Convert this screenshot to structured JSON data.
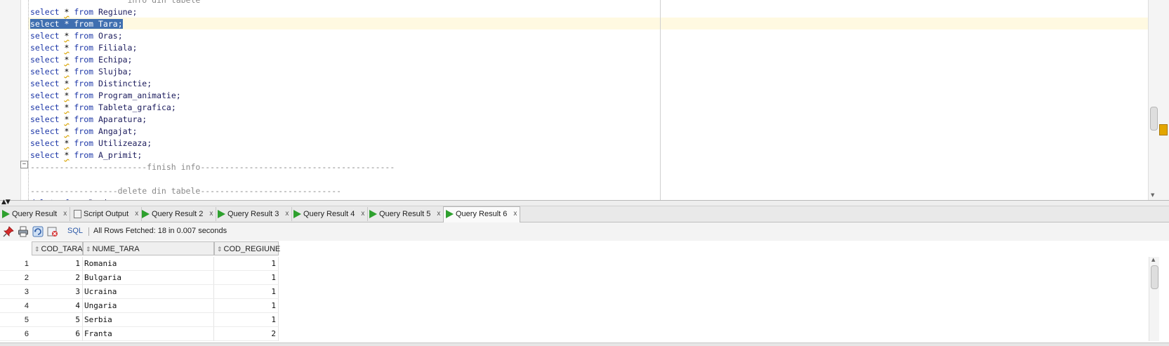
{
  "editor": {
    "lines": [
      {
        "type": "comment",
        "text": "                    info din tabele"
      },
      {
        "type": "select",
        "kw": "select",
        "star": "*",
        "from": "from",
        "table": "Regiune;"
      },
      {
        "type": "select",
        "kw": "select",
        "star": "*",
        "from": "from",
        "table": "Tara;",
        "selected": true
      },
      {
        "type": "select",
        "kw": "select",
        "star": "*",
        "from": "from",
        "table": "Oras;"
      },
      {
        "type": "select",
        "kw": "select",
        "star": "*",
        "from": "from",
        "table": "Filiala;"
      },
      {
        "type": "select",
        "kw": "select",
        "star": "*",
        "from": "from",
        "table": "Echipa;"
      },
      {
        "type": "select",
        "kw": "select",
        "star": "*",
        "from": "from",
        "table": "Slujba;"
      },
      {
        "type": "select",
        "kw": "select",
        "star": "*",
        "from": "from",
        "table": "Distinctie;"
      },
      {
        "type": "select",
        "kw": "select",
        "star": "*",
        "from": "from",
        "table": "Program_animatie;"
      },
      {
        "type": "select",
        "kw": "select",
        "star": "*",
        "from": "from",
        "table": "Tableta_grafica;"
      },
      {
        "type": "select",
        "kw": "select",
        "star": "*",
        "from": "from",
        "table": "Aparatura;"
      },
      {
        "type": "select",
        "kw": "select",
        "star": "*",
        "from": "from",
        "table": "Angajat;"
      },
      {
        "type": "select",
        "kw": "select",
        "star": "*",
        "from": "from",
        "table": "Utilizeaza;"
      },
      {
        "type": "select",
        "kw": "select",
        "star": "*",
        "from": "from",
        "table": "A_primit;"
      },
      {
        "type": "comment",
        "text": "------------------------finish info----------------------------------------"
      },
      {
        "type": "blank",
        "text": ""
      },
      {
        "type": "comment",
        "text": "------------------delete din tabele-----------------------------"
      },
      {
        "type": "delete",
        "kw": "delete",
        "from": "from",
        "table": "Regiune;"
      }
    ],
    "fold_toggle": "−",
    "splitter_arrows": "▲▼"
  },
  "tabs": [
    {
      "label": "Query Result",
      "icon": "play-icon",
      "close": "x"
    },
    {
      "label": "Script Output",
      "icon": "script-icon",
      "close": "x"
    },
    {
      "label": "Query Result 2",
      "icon": "play-icon",
      "close": "x"
    },
    {
      "label": "Query Result 3",
      "icon": "play-icon",
      "close": "x"
    },
    {
      "label": "Query Result 4",
      "icon": "play-icon",
      "close": "x"
    },
    {
      "label": "Query Result 5",
      "icon": "play-icon",
      "close": "x"
    },
    {
      "label": "Query Result 6",
      "icon": "play-icon",
      "close": "x",
      "active": true
    }
  ],
  "toolbar": {
    "sql_label": "SQL",
    "status": "All Rows Fetched: 18 in 0.007 seconds",
    "icons": [
      "pin-icon",
      "print-icon",
      "refresh-icon",
      "cancel-icon"
    ]
  },
  "grid": {
    "columns": [
      "COD_TARA",
      "NUME_TARA",
      "COD_REGIUNE"
    ],
    "sort_glyph": "⇕",
    "rows": [
      {
        "n": "1",
        "cod_tara": "1",
        "nume_tara": "Romania",
        "cod_regiune": "1"
      },
      {
        "n": "2",
        "cod_tara": "2",
        "nume_tara": "Bulgaria",
        "cod_regiune": "1"
      },
      {
        "n": "3",
        "cod_tara": "3",
        "nume_tara": "Ucraina",
        "cod_regiune": "1"
      },
      {
        "n": "4",
        "cod_tara": "4",
        "nume_tara": "Ungaria",
        "cod_regiune": "1"
      },
      {
        "n": "5",
        "cod_tara": "5",
        "nume_tara": "Serbia",
        "cod_regiune": "1"
      },
      {
        "n": "6",
        "cod_tara": "6",
        "nume_tara": "Franta",
        "cod_regiune": "2"
      }
    ]
  },
  "colors": {
    "selection": "#3f6fb0",
    "keyword": "#1e38a8",
    "current_line": "#fff9e1",
    "run_icon": "#2da02d",
    "overview_marker": "#e3a600"
  }
}
